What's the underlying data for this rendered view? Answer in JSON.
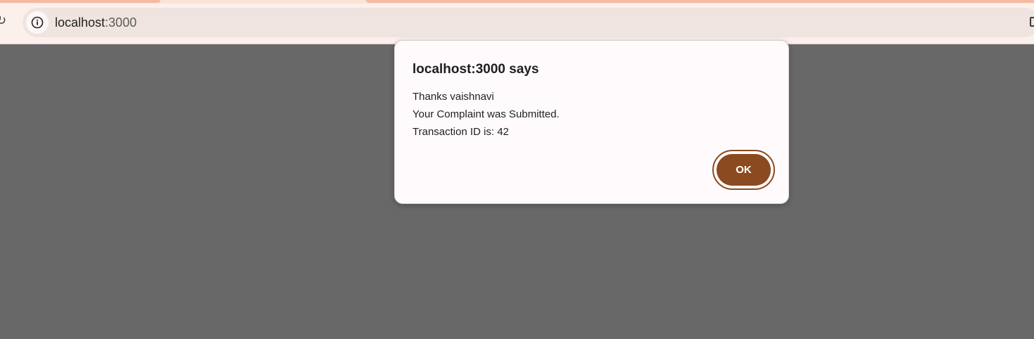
{
  "browser": {
    "url_host": "localhost",
    "url_port": ":3000",
    "icons": {
      "reload": "reload-icon",
      "site_info": "info-icon",
      "side_panel": "side-panel-icon"
    }
  },
  "dialog": {
    "title": "localhost:3000 says",
    "lines": [
      "Thanks vaishnavi",
      "Your Complaint was Submitted.",
      "Transaction ID is: 42"
    ],
    "ok_label": "OK",
    "accent_color": "#8b4a1f"
  },
  "colors": {
    "overlay": "#686868",
    "chrome_bg": "#fbf0ec",
    "dialog_bg": "#fffbfc"
  }
}
